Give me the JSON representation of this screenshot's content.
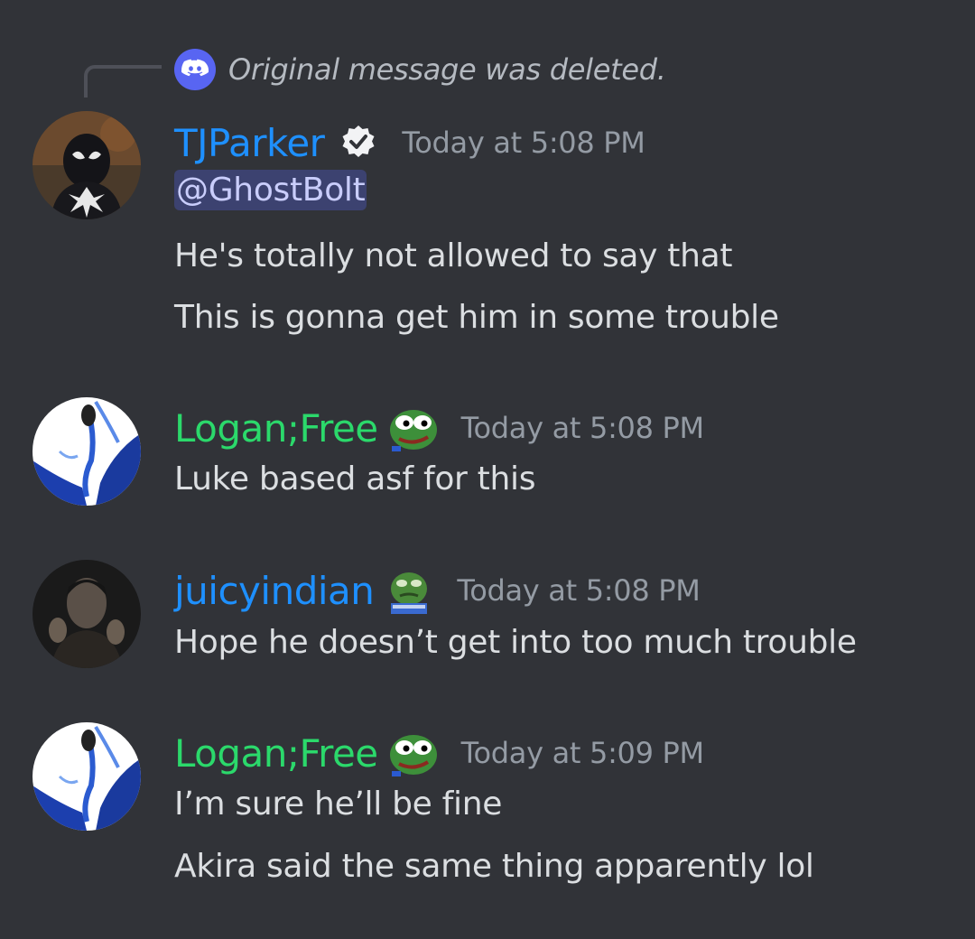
{
  "reply": {
    "text": "Original message was deleted."
  },
  "messages": [
    {
      "username": "TJParker",
      "username_color": "#1e90ff",
      "badge": "verified-check-icon",
      "timestamp": "Today at 5:08 PM",
      "mention": "@GhostBolt",
      "lines": [
        "He's totally not allowed to say that",
        "This is gonna get him in some trouble"
      ]
    },
    {
      "username": "Logan;Free",
      "username_color": "#2bd96b",
      "badge": "pepe-emoji-icon",
      "timestamp": "Today at 5:08 PM",
      "lines": [
        "Luke based asf for this"
      ]
    },
    {
      "username": "juicyindian",
      "username_color": "#1e90ff",
      "badge": "pepe-emoji-icon",
      "timestamp": "Today at 5:08 PM",
      "lines": [
        "Hope he doesn’t get into too much trouble"
      ]
    },
    {
      "username": "Logan;Free",
      "username_color": "#2bd96b",
      "badge": "pepe-emoji-icon",
      "timestamp": "Today at 5:09 PM",
      "lines": [
        "I’m sure he’ll be fine",
        "Akira said the same thing apparently lol"
      ]
    }
  ]
}
